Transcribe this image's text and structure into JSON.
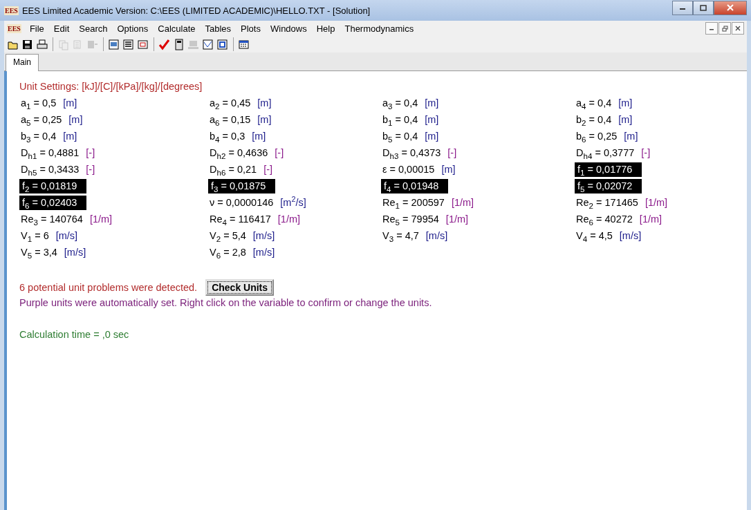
{
  "window": {
    "logo": "EES",
    "title": "EES Limited Academic Version:  C:\\EES (LIMITED ACADEMIC)\\HELLO.TXT - [Solution]"
  },
  "menu": {
    "logo": "EES",
    "items": [
      "File",
      "Edit",
      "Search",
      "Options",
      "Calculate",
      "Tables",
      "Plots",
      "Windows",
      "Help",
      "Thermodynamics"
    ]
  },
  "toolbar_groups": [
    [
      {
        "disabled": false
      },
      {
        "disabled": false
      },
      {
        "disabled": false
      }
    ],
    [
      {
        "disabled": true
      },
      {
        "disabled": true
      },
      {
        "disabled": true
      }
    ],
    [
      {
        "disabled": false
      },
      {
        "disabled": false
      },
      {
        "disabled": false
      }
    ],
    [
      {
        "disabled": false
      },
      {
        "disabled": false
      },
      {
        "disabled": true
      },
      {
        "disabled": false
      },
      {
        "disabled": false
      }
    ],
    [
      {
        "disabled": false
      }
    ]
  ],
  "tabs": [
    {
      "label": "Main",
      "selected": true
    }
  ],
  "unit_settings": "Unit Settings: [kJ]/[C]/[kPa]/[kg]/[degrees]",
  "variables": [
    {
      "name": "a$_{1}$",
      "value": "0,5",
      "unit": "[m]",
      "auto_set": false,
      "highlighted": false
    },
    {
      "name": "a$_{2}$",
      "value": "0,45",
      "unit": "[m]",
      "auto_set": false,
      "highlighted": false
    },
    {
      "name": "a$_{3}$",
      "value": "0,4",
      "unit": "[m]",
      "auto_set": false,
      "highlighted": false
    },
    {
      "name": "a$_{4}$",
      "value": "0,4",
      "unit": "[m]",
      "auto_set": false,
      "highlighted": false
    },
    {
      "name": "a$_{5}$",
      "value": "0,25",
      "unit": "[m]",
      "auto_set": false,
      "highlighted": false
    },
    {
      "name": "a$_{6}$",
      "value": "0,15",
      "unit": "[m]",
      "auto_set": false,
      "highlighted": false
    },
    {
      "name": "b$_{1}$",
      "value": "0,4",
      "unit": "[m]",
      "auto_set": false,
      "highlighted": false
    },
    {
      "name": "b$_{2}$",
      "value": "0,4",
      "unit": "[m]",
      "auto_set": false,
      "highlighted": false
    },
    {
      "name": "b$_{3}$",
      "value": "0,4",
      "unit": "[m]",
      "auto_set": false,
      "highlighted": false
    },
    {
      "name": "b$_{4}$",
      "value": "0,3",
      "unit": "[m]",
      "auto_set": false,
      "highlighted": false
    },
    {
      "name": "b$_{5}$",
      "value": "0,4",
      "unit": "[m]",
      "auto_set": false,
      "highlighted": false
    },
    {
      "name": "b$_{6}$",
      "value": "0,25",
      "unit": "[m]",
      "auto_set": false,
      "highlighted": false
    },
    {
      "name": "D$_{h1}$",
      "value": "0,4881",
      "unit": "[-]",
      "auto_set": true,
      "highlighted": false
    },
    {
      "name": "D$_{h2}$",
      "value": "0,4636",
      "unit": "[-]",
      "auto_set": true,
      "highlighted": false
    },
    {
      "name": "D$_{h3}$",
      "value": "0,4373",
      "unit": "[-]",
      "auto_set": true,
      "highlighted": false
    },
    {
      "name": "D$_{h4}$",
      "value": "0,3777",
      "unit": "[-]",
      "auto_set": true,
      "highlighted": false
    },
    {
      "name": "D$_{h5}$",
      "value": "0,3433",
      "unit": "[-]",
      "auto_set": true,
      "highlighted": false
    },
    {
      "name": "D$_{h6}$",
      "value": "0,21",
      "unit": "[-]",
      "auto_set": true,
      "highlighted": false
    },
    {
      "name": "ε",
      "value": "0,00015",
      "unit": "[m]",
      "auto_set": false,
      "highlighted": false
    },
    {
      "name": "f$_{1}$",
      "value": "0,01776",
      "highlighted": true
    },
    {
      "name": "f$_{2}$",
      "value": "0,01819",
      "highlighted": true
    },
    {
      "name": "f$_{3}$",
      "value": "0,01875",
      "highlighted": true
    },
    {
      "name": "f$_{4}$",
      "value": "0,01948",
      "highlighted": true
    },
    {
      "name": "f$_{5}$",
      "value": "0,02072",
      "highlighted": true
    },
    {
      "name": "f$_{6}$",
      "value": "0,02403",
      "highlighted": true
    },
    {
      "name": "ν",
      "value": "0,0000146",
      "unit": "[m$^{2}$/s]",
      "auto_set": false,
      "highlighted": false
    },
    {
      "name": "Re$_{1}$",
      "value": "200597",
      "unit": "[1/m]",
      "auto_set": true,
      "highlighted": false
    },
    {
      "name": "Re$_{2}$",
      "value": "171465",
      "unit": "[1/m]",
      "auto_set": true,
      "highlighted": false
    },
    {
      "name": "Re$_{3}$",
      "value": "140764",
      "unit": "[1/m]",
      "auto_set": true,
      "highlighted": false
    },
    {
      "name": "Re$_{4}$",
      "value": "116417",
      "unit": "[1/m]",
      "auto_set": true,
      "highlighted": false
    },
    {
      "name": "Re$_{5}$",
      "value": "79954",
      "unit": "[1/m]",
      "auto_set": true,
      "highlighted": false
    },
    {
      "name": "Re$_{6}$",
      "value": "40272",
      "unit": "[1/m]",
      "auto_set": true,
      "highlighted": false
    },
    {
      "name": "V$_{1}$",
      "value": "6",
      "unit": "[m/s]",
      "auto_set": false,
      "highlighted": false
    },
    {
      "name": "V$_{2}$",
      "value": "5,4",
      "unit": "[m/s]",
      "auto_set": false,
      "highlighted": false
    },
    {
      "name": "V$_{3}$",
      "value": "4,7",
      "unit": "[m/s]",
      "auto_set": false,
      "highlighted": false
    },
    {
      "name": "V$_{4}$",
      "value": "4,5",
      "unit": "[m/s]",
      "auto_set": false,
      "highlighted": false
    },
    {
      "name": "V$_{5}$",
      "value": "3,4",
      "unit": "[m/s]",
      "auto_set": false,
      "highlighted": false
    },
    {
      "name": "V$_{6}$",
      "value": "2,8",
      "unit": "[m/s]",
      "auto_set": false,
      "highlighted": false
    }
  ],
  "eq_sign": "=",
  "warning": "6 potential unit problems were detected.",
  "check_button": "Check Units",
  "info": "Purple units were automatically set.  Right click on the variable to confirm or change the units.",
  "calc_time": "Calculation time = ,0 sec"
}
